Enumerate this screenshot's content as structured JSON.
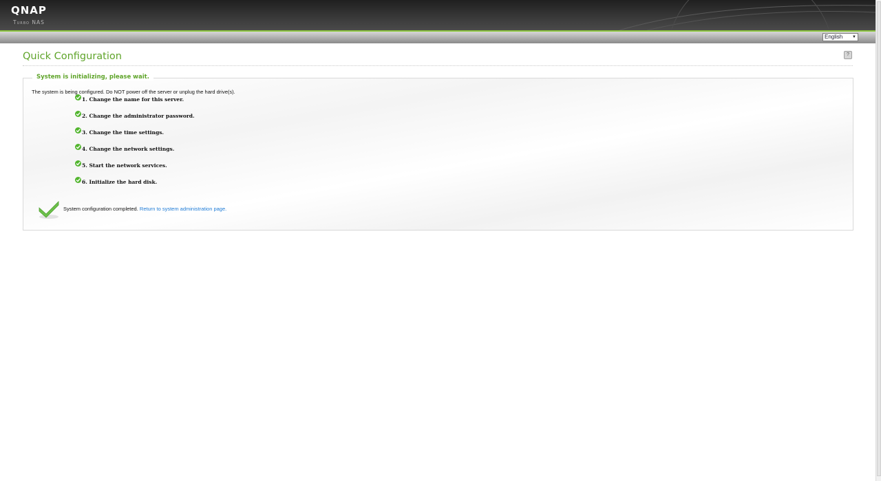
{
  "header": {
    "logo_text": "QNAP",
    "sub_logo_text": "Turbo NAS",
    "accent_color": "#8dc63f"
  },
  "language": {
    "selected": "English"
  },
  "page": {
    "title": "Quick Configuration",
    "help_icon": "help-icon"
  },
  "panel": {
    "legend": "System is initializing, please wait.",
    "warning": "The system is being configured. Do NOT power off the server or unplug the hard drive(s).",
    "steps": [
      {
        "label": "1. Change the name for this server.",
        "status_icon": "check-icon"
      },
      {
        "label": "2. Change the administrator password.",
        "status_icon": "check-icon"
      },
      {
        "label": "3. Change the time settings.",
        "status_icon": "check-icon"
      },
      {
        "label": "4. Change the network settings.",
        "status_icon": "check-icon"
      },
      {
        "label": "5. Start the network services.",
        "status_icon": "check-icon"
      },
      {
        "label": "6. Initialize the hard disk.",
        "status_icon": "check-icon"
      }
    ],
    "completion_text": "System configuration completed.",
    "return_link": "Return to system administration page."
  },
  "colors": {
    "title_green": "#5fa42a",
    "link_blue": "#1e7bd6",
    "check_green": "#52b52e"
  }
}
